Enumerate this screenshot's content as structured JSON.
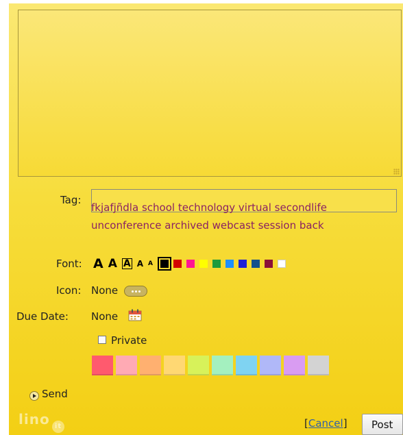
{
  "editor": {
    "placeholder": ""
  },
  "tag": {
    "label": "Tag:",
    "value": "",
    "suggestions": [
      "fkjafjñdla",
      "school",
      "technology",
      "virtual",
      "secondlife",
      "unconference",
      "archived",
      "webcast",
      "session",
      "back"
    ]
  },
  "font": {
    "label": "Font:",
    "sizes": [
      "A",
      "A",
      "A",
      "A",
      "A"
    ],
    "colors": [
      "#000000",
      "#d40000",
      "#ff1493",
      "#ffff00",
      "#1e9b3c",
      "#1e90ff",
      "#1f1fd6",
      "#14508c",
      "#8b1038",
      "#ffffff"
    ]
  },
  "icon": {
    "label": "Icon:",
    "value": "None"
  },
  "due_date": {
    "label": "Due Date:",
    "value": "None"
  },
  "private": {
    "label": "Private",
    "checked": false
  },
  "note_colors": [
    "#ff5a6e",
    "#ffaab4",
    "#ffb070",
    "#ffd873",
    "#d7f25a",
    "#a4f0bf",
    "#7fd3f2",
    "#b0b8f8",
    "#d99cf2",
    "#d3d3d3"
  ],
  "send": {
    "label": "Send"
  },
  "logo": {
    "text": "lino",
    "badge": "it"
  },
  "actions": {
    "cancel_open": "[",
    "cancel": "Cancel",
    "cancel_close": "]",
    "post": "Post"
  }
}
